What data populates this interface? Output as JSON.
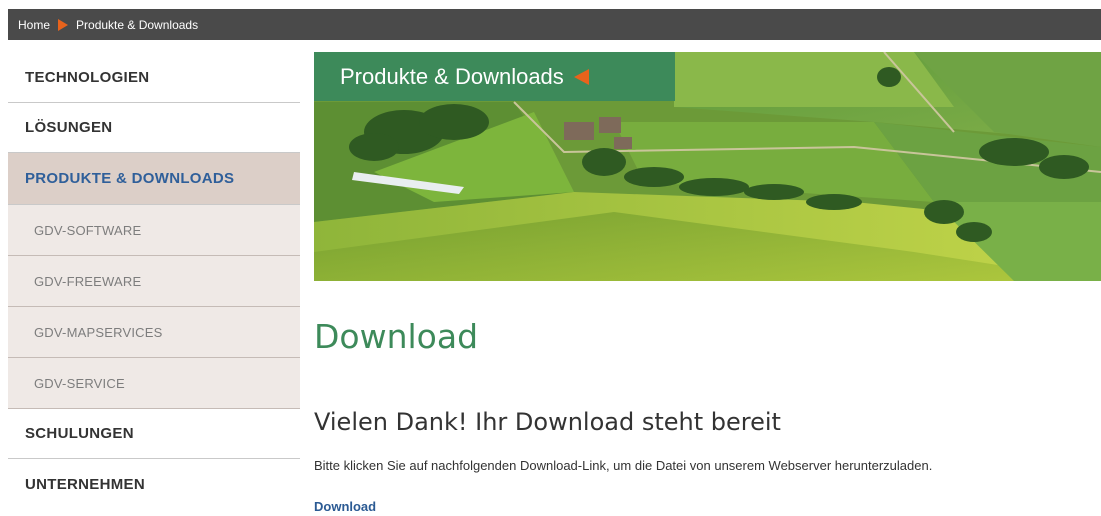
{
  "breadcrumb": {
    "items": [
      "Home",
      "Produkte & Downloads"
    ]
  },
  "sidebar": {
    "items": [
      {
        "label": "TECHNOLOGIEN"
      },
      {
        "label": "LÖSUNGEN"
      },
      {
        "label": "PRODUKTE & DOWNLOADS",
        "active": true
      },
      {
        "label": "GDV-SOFTWARE"
      },
      {
        "label": "GDV-FREEWARE"
      },
      {
        "label": "GDV-MAPSERVICES"
      },
      {
        "label": "GDV-SERVICE"
      },
      {
        "label": "SCHULUNGEN"
      },
      {
        "label": "UNTERNEHMEN"
      }
    ]
  },
  "banner": {
    "title": "Produkte & Downloads",
    "image": "aerial-farmland-photo"
  },
  "main": {
    "heading": "Download",
    "subheading": "Vielen Dank! Ihr Download steht bereit",
    "description": "Bitte klicken Sie auf nachfolgenden Download-Link, um die Datei von unserem Webserver herunterzuladen.",
    "link_label": "Download"
  },
  "colors": {
    "accent_green": "#3d8a5a",
    "accent_orange": "#e8631c",
    "link_blue": "#2b5a93",
    "breadcrumb_bg": "#4a4a4a",
    "active_nav_bg": "#dccfc8",
    "sub_nav_bg": "#efe9e6"
  }
}
